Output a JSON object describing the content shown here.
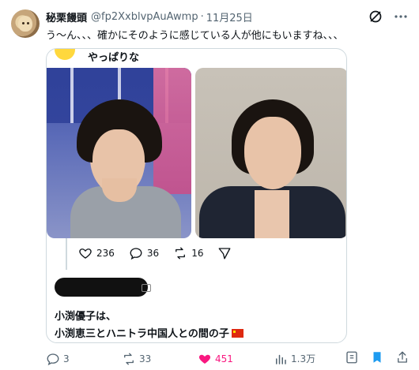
{
  "tweet": {
    "display_name": "秘栗饅頭",
    "handle": "@fp2XxblvpAuAwmp",
    "separator": "·",
    "date": "11月25日",
    "text": "う～ん、、、確かにそのように感じている人が他にもいますね、、、",
    "icons": {
      "grok": "grok-icon",
      "more": "more-icon"
    }
  },
  "quote": {
    "title": "やっぱりな",
    "stats": {
      "likes": "236",
      "replies": "36",
      "retweets": "16"
    },
    "reply_line1": "小渕優子は、",
    "reply_line2": "小渕恵三とハニトラ中国人との間の子"
  },
  "actions": {
    "replies": "3",
    "retweets": "33",
    "likes": "451",
    "views": "1.3万"
  },
  "colors": {
    "like_active": "#f91880",
    "bookmark": "#1d9bf0",
    "muted": "#536471"
  }
}
